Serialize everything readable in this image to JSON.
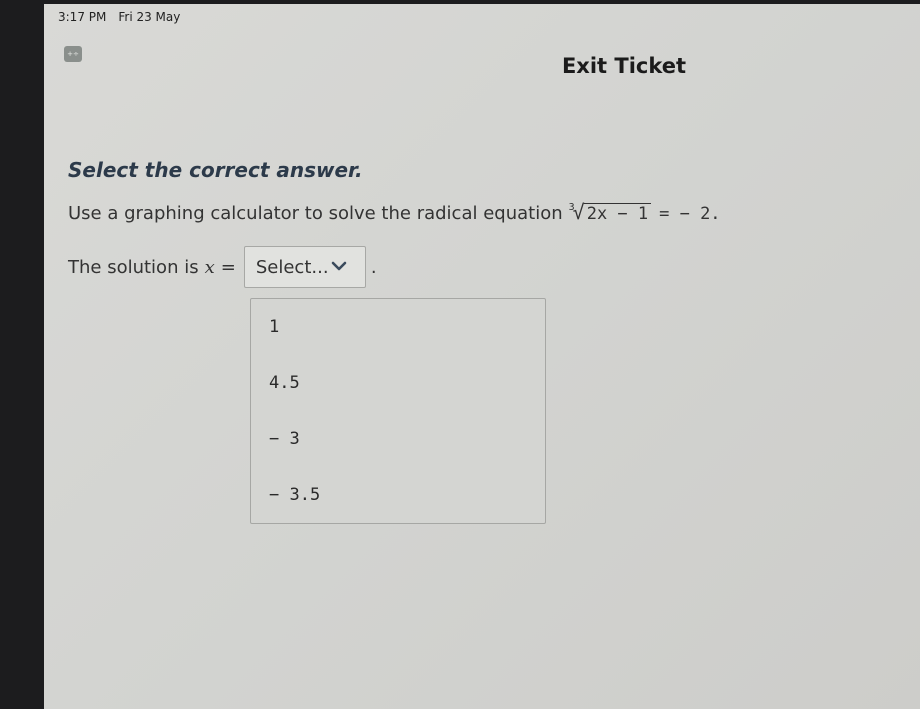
{
  "status_bar": {
    "time": "3:17 PM",
    "date": "Fri 23 May"
  },
  "header": {
    "title": "Exit Ticket",
    "app_icon": "calculator-icon"
  },
  "question": {
    "instruction": "Select the correct answer.",
    "prompt": "Use a graphing calculator to solve the radical equation",
    "equation": {
      "root_index": "3",
      "radicand": "2x − 1",
      "rhs": "= − 2."
    },
    "solution_prefix": "The solution is",
    "variable": "x",
    "equals": "=",
    "period": "."
  },
  "dropdown": {
    "selected": "Select...",
    "icon": "chevron-down-icon",
    "options": [
      "1",
      "4.5",
      "− 3",
      "− 3.5"
    ]
  },
  "colors": {
    "background": "#d6d7d4",
    "instruction_text": "#2c3a4a",
    "bezel": "#1c1c1e"
  }
}
